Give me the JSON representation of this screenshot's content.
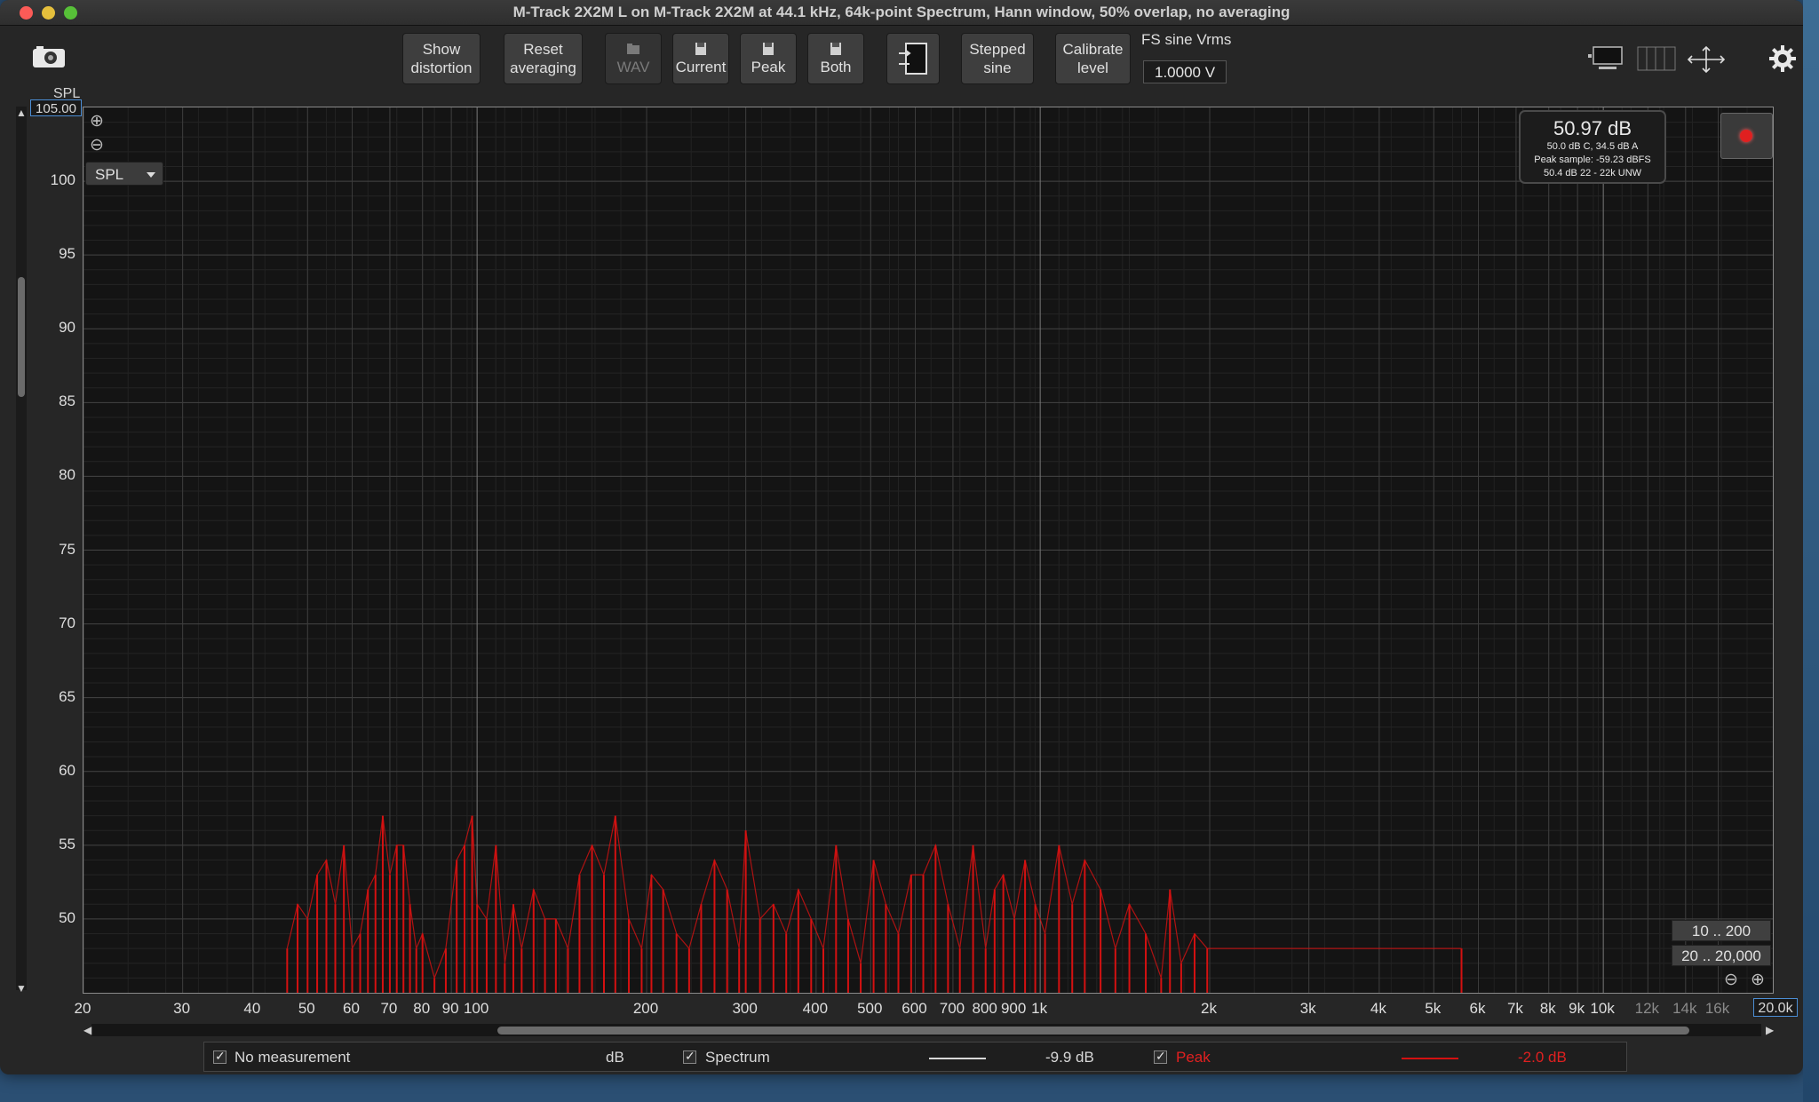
{
  "window": {
    "title": "M-Track 2X2M  L on M-Track 2X2M at 44.1 kHz, 64k-point Spectrum, Hann window, 50% overlap, no averaging"
  },
  "toolbar": {
    "show_distortion": "Show\ndistortion",
    "reset_averaging": "Reset\naveraging",
    "wav": "WAV",
    "current": "Current",
    "peak": "Peak",
    "both": "Both",
    "stepped_sine": "Stepped\nsine",
    "calibrate_level": "Calibrate\nlevel",
    "fs_label": "FS sine Vrms",
    "fs_value": "1.0000 V"
  },
  "plot": {
    "y_axis_label": "SPL",
    "top_value": "105.00",
    "right_value": "20.0k",
    "selector": "SPL",
    "readout": {
      "main": "50.97 dB",
      "line1": "50.0 dB C, 34.5 dB A",
      "line2": "Peak sample: -59.23 dBFS",
      "line3": "50.4 dB 22 - 22k UNW"
    },
    "range_buttons": [
      "10 .. 200",
      "20 .. 20,000"
    ]
  },
  "legend": {
    "no_measurement": "No measurement",
    "unit": "dB",
    "spectrum_label": "Spectrum",
    "spectrum_value": "-9.9 dB",
    "peak_label": "Peak",
    "peak_value": "-2.0 dB"
  },
  "colors": {
    "peak_trace": "#d41111",
    "spectrum_trace": "#cfcfcf",
    "selected_field_border": "#4b8dd4"
  },
  "chart_data": {
    "type": "line",
    "xscale": "log",
    "xlim": [
      20,
      20000
    ],
    "ylim": [
      45,
      105
    ],
    "ylabel": "SPL",
    "y_ticks": [
      100,
      95,
      90,
      85,
      80,
      75,
      70,
      65,
      60,
      55,
      50
    ],
    "x_ticks": [
      "20",
      "30",
      "40",
      "50",
      "60",
      "70",
      "80",
      "90",
      "100",
      "200",
      "300",
      "400",
      "500",
      "600",
      "700",
      "800",
      "900",
      "1k",
      "2k",
      "3k",
      "4k",
      "5k",
      "6k",
      "7k",
      "8k",
      "9k",
      "10k",
      "12k",
      "14k",
      "16k"
    ],
    "x_tick_values": [
      20,
      30,
      40,
      50,
      60,
      70,
      80,
      90,
      100,
      200,
      300,
      400,
      500,
      600,
      700,
      800,
      900,
      1000,
      2000,
      3000,
      4000,
      5000,
      6000,
      7000,
      8000,
      9000,
      10000,
      12000,
      14000,
      16000
    ],
    "x_ticks_dim": [
      "12k",
      "14k",
      "16k"
    ],
    "grid": true,
    "series": [
      {
        "name": "Peak",
        "x": [
          46,
          48,
          50,
          52,
          54,
          56,
          58,
          60,
          62,
          64,
          66,
          68,
          70,
          72,
          74,
          76,
          78,
          80,
          84,
          88,
          92,
          95,
          98,
          100,
          104,
          108,
          112,
          116,
          120,
          126,
          132,
          138,
          145,
          152,
          160,
          168,
          176,
          186,
          196,
          204,
          214,
          226,
          238,
          250,
          264,
          278,
          292,
          300,
          318,
          336,
          354,
          372,
          392,
          412,
          434,
          456,
          480,
          506,
          532,
          560,
          590,
          620,
          652,
          686,
          720,
          760,
          800,
          830,
          860,
          900,
          940,
          980,
          1020,
          1080,
          1140,
          1200,
          1280,
          1360,
          1440,
          1540,
          1640,
          1700,
          1780,
          1880,
          1980,
          5600
        ],
        "y": [
          48,
          51,
          50,
          53,
          54,
          51,
          55,
          48,
          49,
          52,
          53,
          57,
          53,
          55,
          55,
          51,
          48,
          49,
          46,
          48,
          54,
          55,
          57,
          51,
          50,
          55,
          47,
          51,
          48,
          52,
          50,
          50,
          48,
          53,
          55,
          53,
          57,
          50,
          48,
          53,
          52,
          49,
          48,
          51,
          54,
          52,
          48,
          56,
          50,
          51,
          49,
          52,
          50,
          48,
          55,
          50,
          47,
          54,
          51,
          49,
          53,
          53,
          55,
          51,
          48,
          55,
          48,
          52,
          53,
          50,
          54,
          51,
          49,
          55,
          51,
          54,
          52,
          48,
          51,
          49,
          46,
          52,
          47,
          49,
          48,
          48
        ]
      }
    ]
  }
}
